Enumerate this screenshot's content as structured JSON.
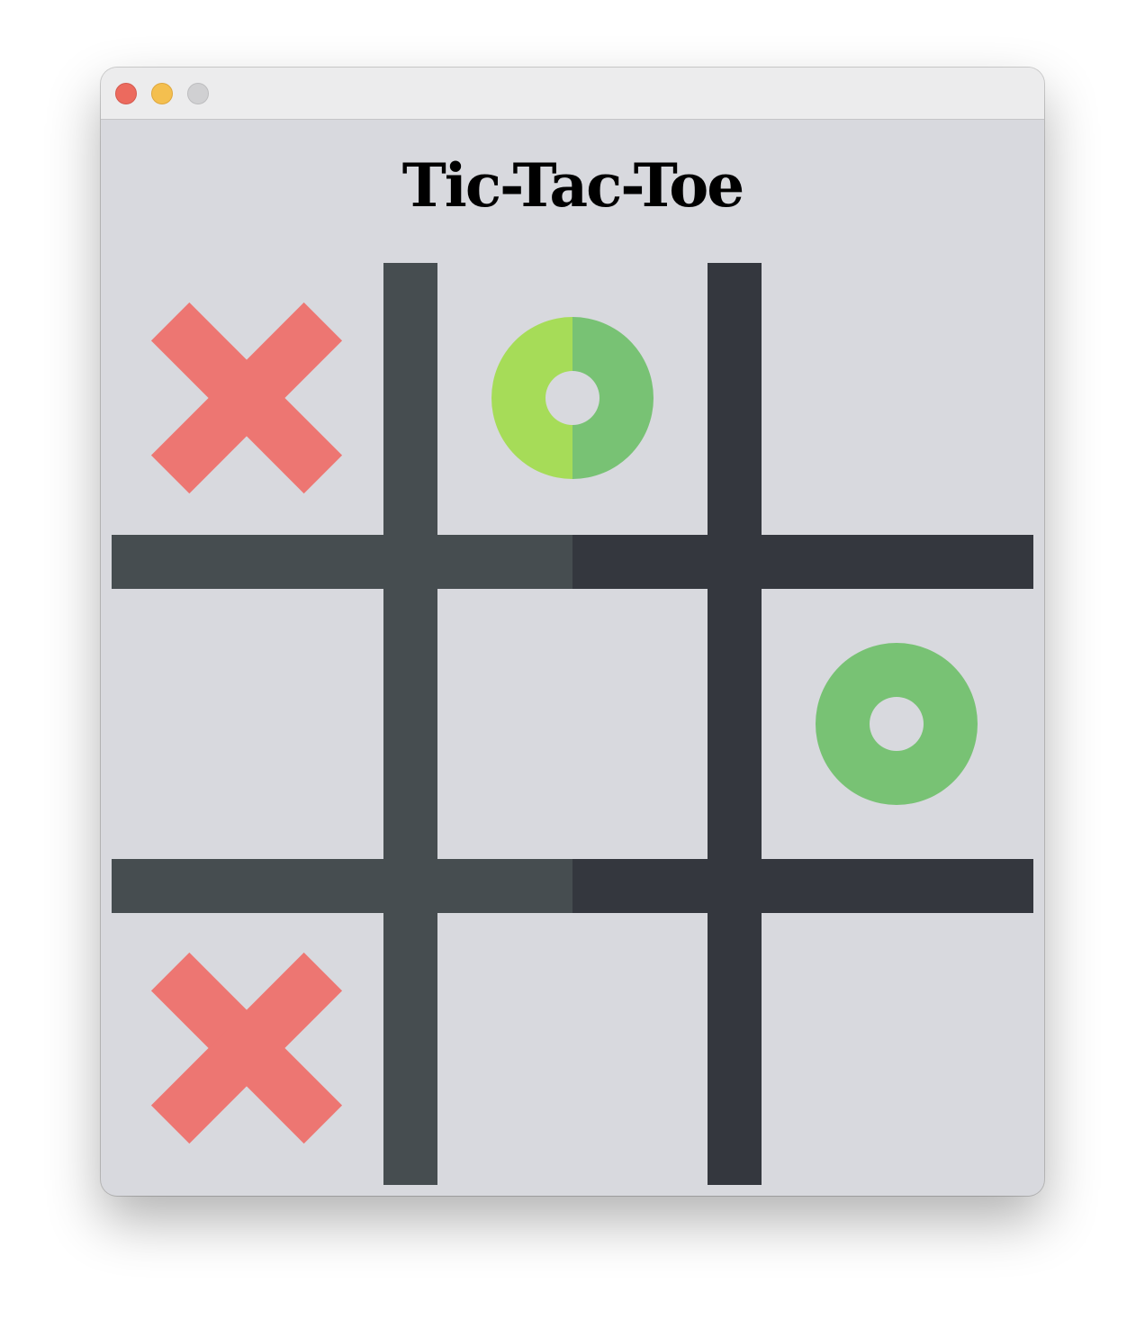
{
  "window": {
    "title": "Tic-Tac-Toe"
  },
  "colors": {
    "background": "#d8d9de",
    "grid_left": "#464d50",
    "grid_right": "#34373e",
    "x_mark": "#ed7672",
    "o_mark": "#78c274",
    "o_mark_light": "#a6dc58"
  },
  "board": {
    "cells": [
      [
        "X",
        "O",
        ""
      ],
      [
        "",
        "",
        "O"
      ],
      [
        "X",
        "",
        ""
      ]
    ]
  }
}
